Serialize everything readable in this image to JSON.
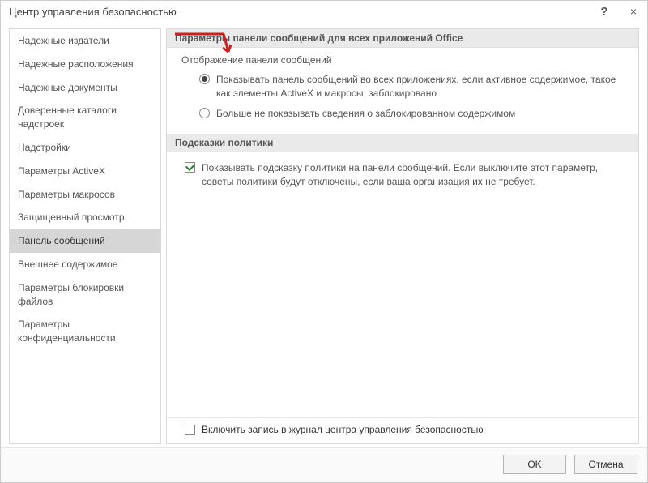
{
  "title": "Центр управления безопасностью",
  "help_char": "?",
  "close_char": "×",
  "sidebar": {
    "items": [
      {
        "label": "Надежные издатели",
        "selected": false
      },
      {
        "label": "Надежные расположения",
        "selected": false
      },
      {
        "label": "Надежные документы",
        "selected": false
      },
      {
        "label": "Доверенные каталоги надстроек",
        "selected": false
      },
      {
        "label": "Надстройки",
        "selected": false
      },
      {
        "label": "Параметры ActiveX",
        "selected": false
      },
      {
        "label": "Параметры макросов",
        "selected": false
      },
      {
        "label": "Защищенный просмотр",
        "selected": false
      },
      {
        "label": "Панель сообщений",
        "selected": true
      },
      {
        "label": "Внешнее содержимое",
        "selected": false
      },
      {
        "label": "Параметры блокировки файлов",
        "selected": false
      },
      {
        "label": "Параметры конфиденциальности",
        "selected": false
      }
    ]
  },
  "sections": {
    "message_bar": {
      "heading": "Параметры панели сообщений для всех приложений Office",
      "subheading": "Отображение панели сообщений",
      "options": [
        {
          "label": "Показывать панель сообщений во всех приложениях, если активное содержимое, такое как элементы ActiveX и макросы, заблокировано",
          "checked": true
        },
        {
          "label": "Больше не показывать сведения о заблокированном содержимом",
          "checked": false
        }
      ]
    },
    "policy": {
      "heading": "Подсказки политики",
      "options": [
        {
          "label": "Показывать подсказку политики на панели сообщений. Если выключите этот параметр, советы политики будут отключены, если ваша организация их не требует.",
          "checked": true
        }
      ]
    },
    "log": {
      "label": "Включить запись в журнал центра управления безопасностью",
      "checked": false
    }
  },
  "buttons": {
    "ok": "OK",
    "cancel": "Отмена"
  }
}
